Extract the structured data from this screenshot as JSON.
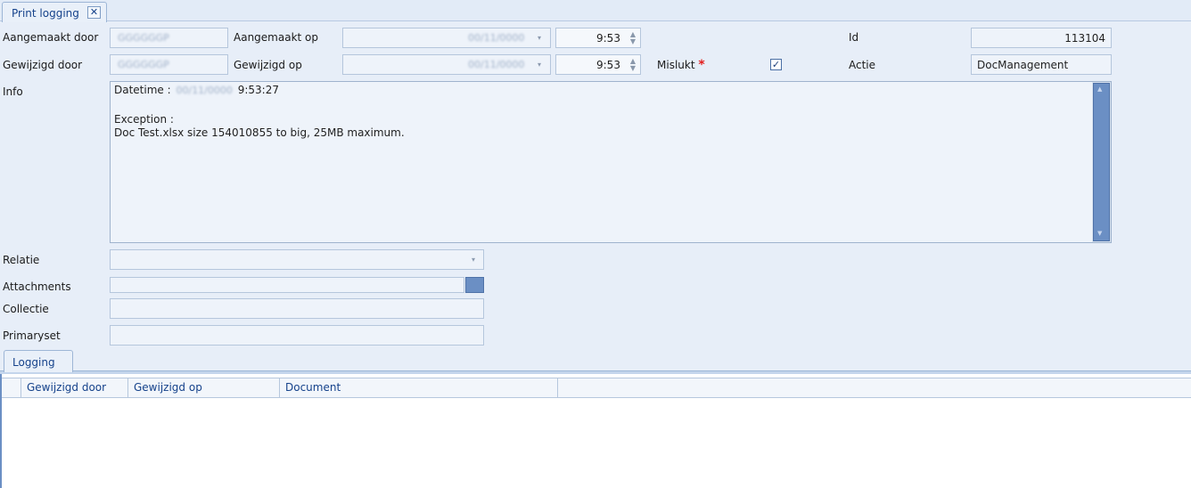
{
  "tab": {
    "title": "Print logging",
    "close": "✕"
  },
  "form": {
    "aangemaakt_door_label": "Aangemaakt door",
    "aangemaakt_door_value": "GGGGGGP",
    "aangemaakt_op_label": "Aangemaakt op",
    "aangemaakt_op_date": "00/11/0000",
    "aangemaakt_op_time": "9:53",
    "id_label": "Id",
    "id_value": "113104",
    "gewijzigd_door_label": "Gewijzigd door",
    "gewijzigd_door_value": "GGGGGGP",
    "gewijzigd_op_label": "Gewijzigd op",
    "gewijzigd_op_date": "00/11/0000",
    "gewijzigd_op_time": "9:53",
    "mislukt_label": "Mislukt",
    "mislukt_required": "*",
    "mislukt_checked": true,
    "actie_label": "Actie",
    "actie_value": "DocManagement",
    "info_label": "Info",
    "info_line1_prefix": "Datetime :",
    "info_line1_date": "00/11/0000",
    "info_line1_time": "9:53:27",
    "info_line2": "Exception :",
    "info_line3": "Doc Test.xlsx size 154010855 to big, 25MB maximum.",
    "relatie_label": "Relatie",
    "attachments_label": "Attachments",
    "collectie_label": "Collectie",
    "primaryset_label": "Primaryset"
  },
  "logging": {
    "tab_label": "Logging",
    "columns": [
      "Gewijzigd door",
      "Gewijzigd op",
      "Document"
    ]
  },
  "colors": {
    "accent": "#15428b",
    "background": "#e7eef8",
    "scroll_thumb": "#6b8fc4"
  }
}
